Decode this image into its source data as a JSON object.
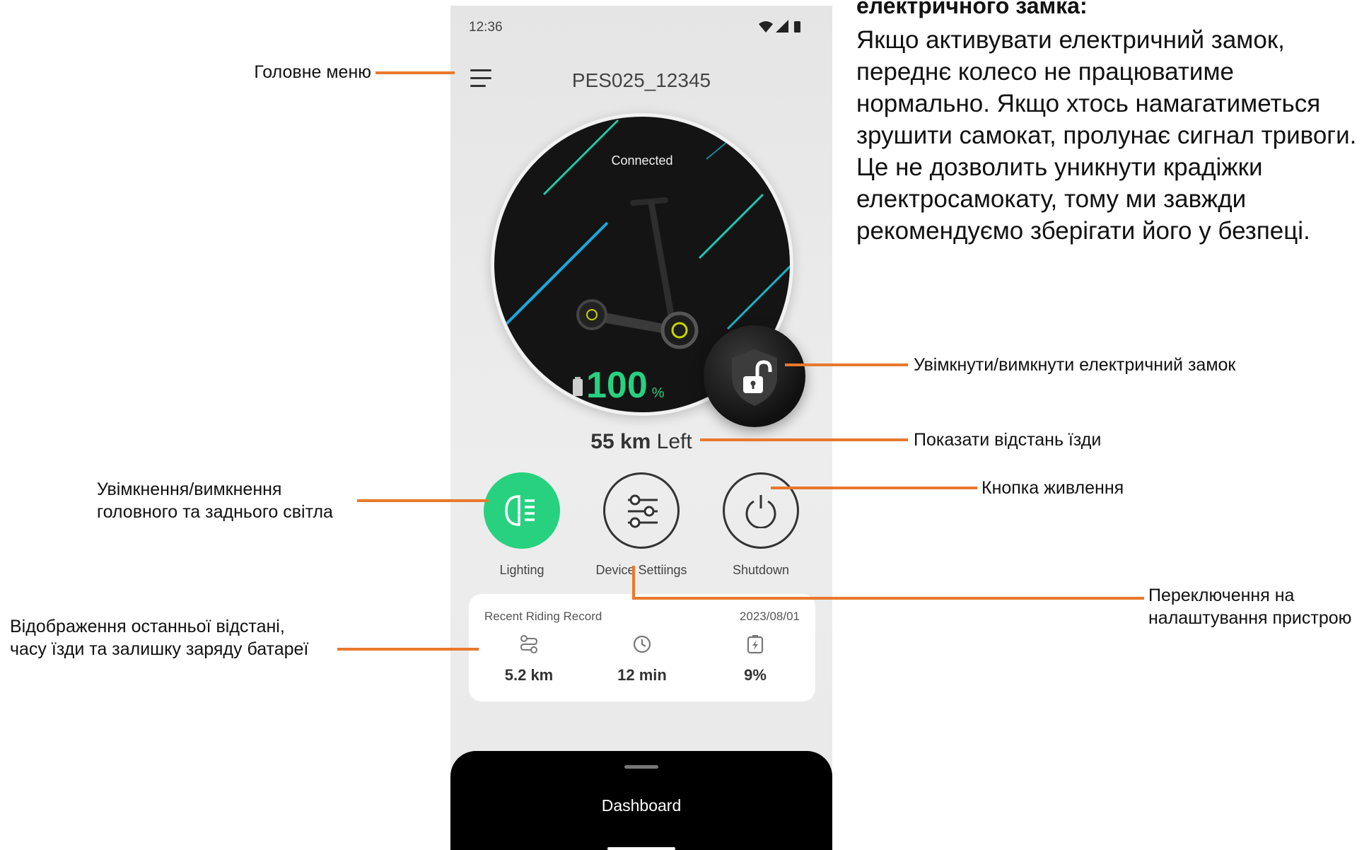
{
  "status_bar": {
    "time": "12:36"
  },
  "header": {
    "device_name": "PES025_12345"
  },
  "hero": {
    "connection_status": "Connected",
    "battery_percent": "100",
    "battery_unit": "%",
    "lock_state": "unlocked"
  },
  "range": {
    "value": "55 km",
    "suffix": " Left"
  },
  "controls": [
    {
      "label": "Lighting",
      "icon": "headlight-icon",
      "active": true
    },
    {
      "label": "Device Settiings",
      "icon": "sliders-icon",
      "active": false
    },
    {
      "label": "Shutdown",
      "icon": "power-icon",
      "active": false
    }
  ],
  "recent_record": {
    "title": "Recent Riding Record",
    "date": "2023/08/01",
    "stats": [
      {
        "icon": "route-icon",
        "value": "5.2 km"
      },
      {
        "icon": "clock-icon",
        "value": "12 min"
      },
      {
        "icon": "battery-charge-icon",
        "value": "9%"
      }
    ]
  },
  "bottom_sheet": {
    "title": "Dashboard"
  },
  "annotations": {
    "heading": "електричного замка:",
    "paragraph": "Якщо активувати електричний замок, переднє колесо не працюватиме нормально. Якщо хтось намагатиметься зрушити самокат, пролунає сигнал тривоги. Це не дозволить уникнути крадіжки електросамокату, тому ми завжди рекомендуємо зберігати його у безпеці.",
    "main_menu": "Головне меню",
    "lock_toggle": "Увімкнути/вимкнути електричний замок",
    "show_range": "Показати відстань їзди",
    "power_button": "Кнопка живлення",
    "lighting_line1": "Увімкнення/вимкнення",
    "lighting_line2": "головного та заднього світла",
    "settings_line1": "Переключення на",
    "settings_line2": "налаштування пристрою",
    "record_line1": "Відображення останньої відстані,",
    "record_line2": "часу їзди та залишку заряду батареї"
  },
  "colors": {
    "accent": "#e8782b",
    "green": "#27d17f",
    "sheet": "#000000"
  }
}
